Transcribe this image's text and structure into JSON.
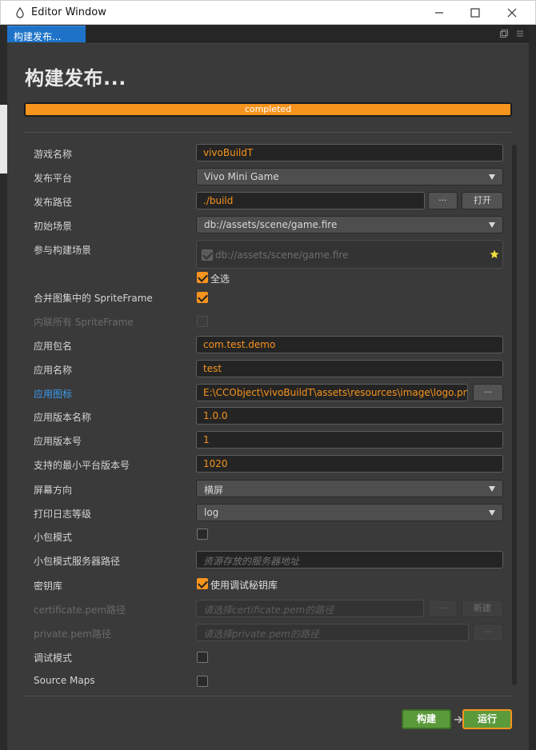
{
  "window": {
    "title": "Editor Window"
  },
  "tab": {
    "label": "构建发布..."
  },
  "header": {
    "title": "构建发布..."
  },
  "progress": {
    "value": 1.0,
    "text": "completed"
  },
  "rows": {
    "game_name": {
      "label": "游戏名称",
      "value": "vivoBuildT"
    },
    "platform": {
      "label": "发布平台",
      "value": "Vivo Mini Game"
    },
    "build_path": {
      "label": "发布路径",
      "value": "./build",
      "browse": "···",
      "open": "打开"
    },
    "start_scene": {
      "label": "初始场景",
      "value": "db://assets/scene/game.fire"
    },
    "scenes": {
      "label": "参与构建场景",
      "items": [
        "db://assets/scene/game.fire"
      ],
      "select_all": "全选"
    },
    "merge_sf": {
      "label": "合并图集中的 SpriteFrame"
    },
    "inline_sf": {
      "label": "内联所有 SpriteFrame"
    },
    "package_name": {
      "label": "应用包名",
      "value": "com.test.demo"
    },
    "app_name": {
      "label": "应用名称",
      "value": "test"
    },
    "app_icon": {
      "label": "应用图标",
      "value": "E:\\CCObject\\vivoBuildT\\assets\\resources\\image\\logo.png",
      "browse": "···"
    },
    "version_name": {
      "label": "应用版本名称",
      "value": "1.0.0"
    },
    "version_number": {
      "label": "应用版本号",
      "value": "1"
    },
    "min_platform": {
      "label": "支持的最小平台版本号",
      "value": "1020"
    },
    "orientation": {
      "label": "屏幕方向",
      "value": "横屏"
    },
    "log_level": {
      "label": "打印日志等级",
      "value": "log"
    },
    "subpackage": {
      "label": "小包模式"
    },
    "subpackage_server": {
      "label": "小包模式服务器路径",
      "placeholder": "资源存放的服务器地址"
    },
    "keystore": {
      "label": "密钥库",
      "option": "使用调试秘钥库"
    },
    "cert_pem": {
      "label": "certificate.pem路径",
      "placeholder": "请选择certificate.pem的路径",
      "browse": "···",
      "new": "新建"
    },
    "private_pem": {
      "label": "private.pem路径",
      "placeholder": "请选择private.pem的路径",
      "browse": "···"
    },
    "debug_mode": {
      "label": "调试模式"
    },
    "source_maps": {
      "label": "Source Maps"
    }
  },
  "footer": {
    "build": "构建",
    "run": "运行"
  },
  "colors": {
    "accent": "#f7941d",
    "link": "#3c9bf0",
    "build_btn": "#5a9a3a"
  }
}
